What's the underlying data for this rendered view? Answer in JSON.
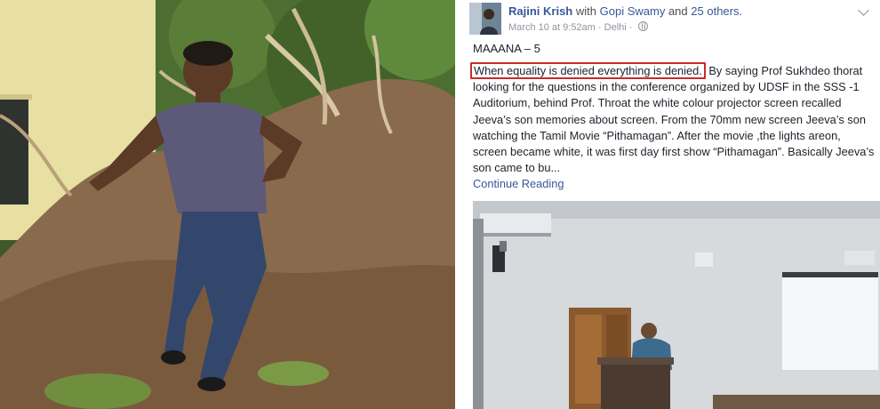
{
  "post": {
    "author": "Rajini Krish",
    "with_text": "with",
    "tagged_person": "Gopi Swamy",
    "and_text": "and",
    "others": "25 others.",
    "date": "March 10 at 9:52am",
    "separator": "·",
    "location": "Delhi ·",
    "title": "MAAANA – 5",
    "highlighted_text": "When equality is denied everything is denied.",
    "body_text": " By saying Prof Sukhdeo thorat looking for the questions in the conference organized by UDSF in the SSS -1 Auditorium, behind Prof. Throat the white colour projector screen recalled Jeeva’s son memories about screen. From the 70mm new screen Jeeva’s son watching the Tamil Movie “Pithamagan”. After the movie ,the lights areon, screen became white, it was first day first show “Pithamagan”. Basically Jeeva’s son came to bu...",
    "continue_label": "Continue Reading",
    "privacy_icon": "globe-icon",
    "menu_icon": "chevron-down-icon"
  },
  "colors": {
    "link": "#365899",
    "highlight_border": "#c92a2a",
    "meta": "#90949c"
  }
}
